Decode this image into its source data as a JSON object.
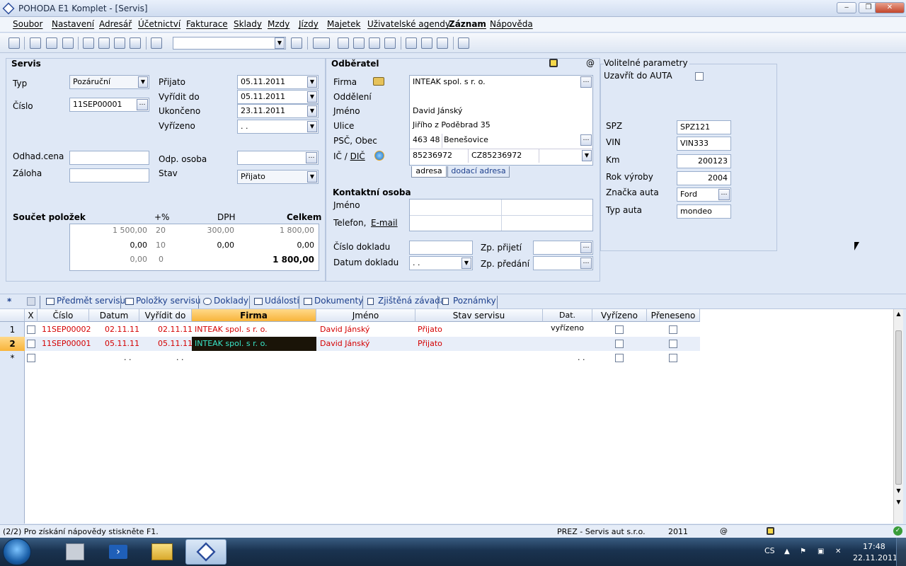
{
  "window": {
    "title": "POHODA E1 Komplet - [Servis]",
    "min": "‒",
    "max": "❐",
    "close": "✕"
  },
  "menu": [
    "Soubor",
    "Nastavení",
    "Adresář",
    "Účetnictví",
    "Fakturace",
    "Sklady",
    "Mzdy",
    "Jízdy",
    "Majetek",
    "Uživatelské agendy",
    "Záznam",
    "Nápověda"
  ],
  "servis": {
    "title": "Servis",
    "typ_label": "Typ",
    "typ_value": "Pozáruční",
    "cislo_label": "Číslo",
    "cislo_value": "11SEP00001",
    "prijato_label": "Přijato",
    "prijato_value": "05.11.2011",
    "vyridit_label": "Vyřídit do",
    "vyridit_value": "05.11.2011",
    "ukonceno_label": "Ukončeno",
    "ukonceno_value": "23.11.2011",
    "vyrizeno_label": "Vyřízeno",
    "vyrizeno_value": ". .",
    "odhad_label": "Odhad.cena",
    "odhad_value": "",
    "zaloha_label": "Záloha",
    "zaloha_value": "",
    "odp_label": "Odp. osoba",
    "odp_value": "",
    "stav_label": "Stav",
    "stav_value": "Přijato",
    "soucet_label": "Součet položek",
    "pct_label": "+%",
    "dph_label": "DPH",
    "celkem_label": "Celkem",
    "sum_rows": [
      {
        "zaklad": "1 500,00",
        "pct": "20",
        "dph": "300,00",
        "celkem": "1 800,00"
      },
      {
        "zaklad": "0,00",
        "pct": "10",
        "dph": "0,00",
        "celkem": "0,00"
      },
      {
        "zaklad": "0,00",
        "pct": "0",
        "dph": "",
        "celkem": "1 800,00"
      }
    ]
  },
  "odberatel": {
    "title": "Odběratel",
    "firma_label": "Firma",
    "firma_value": "INTEAK spol. s r. o.",
    "oddeleni_label": "Oddělení",
    "oddeleni_value": "",
    "jmeno_label": "Jméno",
    "jmeno_value": "David Jánský",
    "ulice_label": "Ulice",
    "ulice_value": "Jiřího z Poděbrad 35",
    "psc_label": "PSČ, Obec",
    "psc_value": "463 48",
    "obec_value": "Benešovice",
    "ic_label": "IČ / ",
    "dic_label": "DIČ",
    "ic_value": "85236972",
    "dic_value": "CZ85236972",
    "tab_adresa": "adresa",
    "tab_dodaci": "dodací adresa",
    "kontakt_title": "Kontaktní osoba",
    "k_jmeno_label": "Jméno",
    "k_telefon_label": "Telefon,",
    "k_email_label": "E-mail",
    "cislo_dokladu_label": "Číslo dokladu",
    "datum_dokladu_label": "Datum dokladu",
    "datum_dokladu_value": ". .",
    "zp_prijeti_label": "Zp. přijetí",
    "zp_predani_label": "Zp. předání"
  },
  "volitelne": {
    "title": "Volitelné parametry",
    "uzavrit_label": "Uzavřít do AUTA",
    "spz_label": "SPZ",
    "spz_value": "SPZ121",
    "vin_label": "VIN",
    "vin_value": "VIN333",
    "km_label": "Km",
    "km_value": "200123",
    "rok_label": "Rok výroby",
    "rok_value": "2004",
    "znacka_label": "Značka auta",
    "znacka_value": "Ford",
    "typ_label": "Typ auta",
    "typ_value": "mondeo"
  },
  "tabs": [
    "Předmět servisu",
    "Položky servisu",
    "Doklady",
    "Události",
    "Dokumenty",
    "Zjištěná závada",
    "Poznámky"
  ],
  "grid": {
    "columns": [
      "X",
      "Číslo",
      "Datum",
      "Vyřídit do",
      "Firma",
      "Jméno",
      "Stav servisu",
      "Dat. vyřízeno",
      "Vyřízeno",
      "Přeneseno"
    ],
    "rows": [
      {
        "n": "1",
        "cislo": "11SEP00002",
        "datum": "02.11.11",
        "vyridit": "02.11.11",
        "firma": "INTEAK spol. s r. o.",
        "jmeno": "David Jánský",
        "stav": "Přijato"
      },
      {
        "n": "2",
        "cislo": "11SEP00001",
        "datum": "05.11.11",
        "vyridit": "05.11.11",
        "firma": "INTEAK spol. s r. o.",
        "jmeno": "David Jánský",
        "stav": "Přijato"
      }
    ],
    "new_row": {
      "n": "*",
      "datum": ". .",
      "vyridit": ". .",
      "dat_vyrizeno": ". ."
    }
  },
  "status": {
    "help": "(2/2) Pro získání nápovědy stiskněte F1.",
    "company": "PREZ - Servis aut s.r.o.",
    "year": "2011",
    "at": "@"
  },
  "taskbar": {
    "lang": "CS",
    "time": "17:48",
    "date": "22.11.2011"
  }
}
